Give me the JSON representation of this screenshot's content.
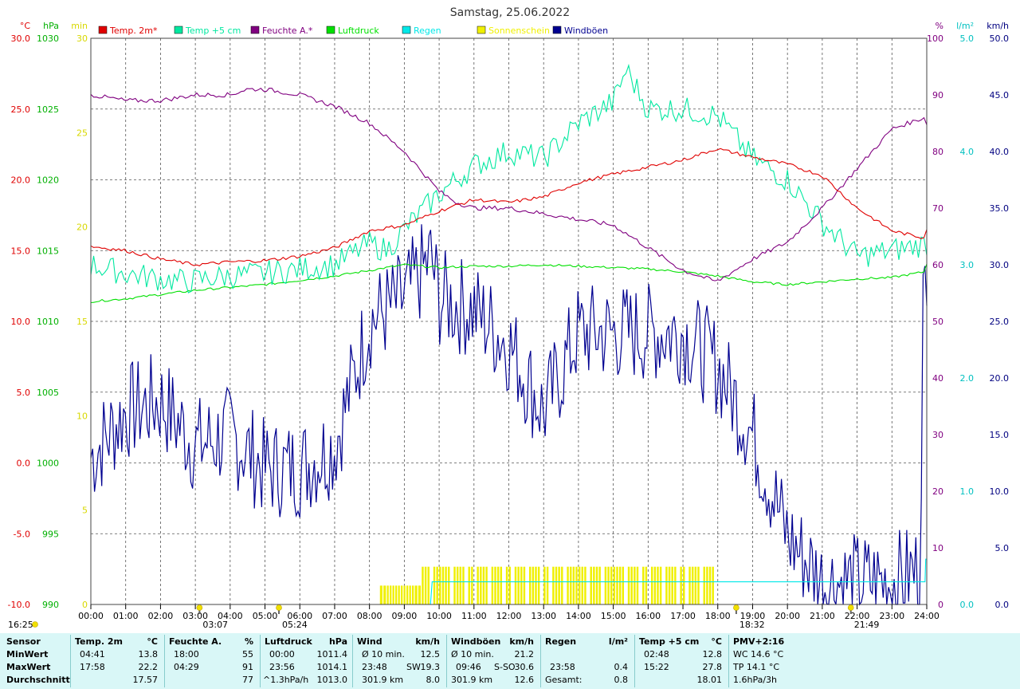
{
  "chart_data": {
    "type": "line",
    "title": "Samstag, 25.06.2022",
    "xlim": [
      "00:00",
      "24:00"
    ],
    "x_ticks": [
      "00:00",
      "01:00",
      "02:00",
      "03:00",
      "04:00",
      "05:00",
      "06:00",
      "07:00",
      "08:00",
      "09:00",
      "10:00",
      "11:00",
      "12:00",
      "13:00",
      "14:00",
      "15:00",
      "16:00",
      "17:00",
      "18:00",
      "19:00",
      "20:00",
      "21:00",
      "22:00",
      "23:00",
      "24:00"
    ],
    "axes": {
      "temp": {
        "unit": "°C",
        "ylim": [
          -10,
          30
        ],
        "ticks": [
          "30.0",
          "25.0",
          "20.0",
          "15.0",
          "10.0",
          "5.0",
          "0.0",
          "-5.0",
          "-10.0"
        ]
      },
      "pressure": {
        "unit": "hPa",
        "ylim": [
          990,
          1030
        ],
        "ticks": [
          "1030",
          "1025",
          "1020",
          "1015",
          "1010",
          "1005",
          "1000",
          "995",
          "990"
        ]
      },
      "sunshine": {
        "unit": "min",
        "ylim": [
          0,
          30
        ],
        "ticks": [
          "30",
          "25",
          "20",
          "15",
          "10",
          "5",
          "0"
        ]
      },
      "humidity": {
        "unit": "%",
        "ylim": [
          0,
          100
        ],
        "ticks": [
          "100",
          "90",
          "80",
          "70",
          "60",
          "50",
          "40",
          "30",
          "20",
          "10",
          "0"
        ]
      },
      "rain": {
        "unit": "l/m²",
        "ylim": [
          0,
          5
        ],
        "ticks": [
          "5.0",
          "4.0",
          "3.0",
          "2.0",
          "1.0",
          "0.0"
        ]
      },
      "wind": {
        "unit": "km/h",
        "ylim": [
          0,
          50
        ],
        "ticks": [
          "50.0",
          "45.0",
          "40.0",
          "35.0",
          "30.0",
          "25.0",
          "20.0",
          "15.0",
          "10.0",
          "5.0",
          "0.0"
        ]
      }
    },
    "legend": [
      {
        "name": "Temp. 2m*",
        "color": "#e00000"
      },
      {
        "name": "Temp +5 cm",
        "color": "#00e8a0"
      },
      {
        "name": "Feuchte A.*",
        "color": "#800080"
      },
      {
        "name": "Luftdruck",
        "color": "#00e000"
      },
      {
        "name": "Regen",
        "color": "#00e8e8"
      },
      {
        "name": "Sonnenschein",
        "color": "#f0f000"
      },
      {
        "name": "Windböen",
        "color": "#000090"
      }
    ],
    "series": [
      {
        "name": "Temp. 2m*",
        "axis": "temp",
        "x": [
          0,
          1,
          2,
          3,
          4,
          5,
          6,
          7,
          8,
          9,
          10,
          11,
          12,
          13,
          14,
          15,
          16,
          17,
          17.97,
          19,
          20,
          21,
          22,
          23,
          23.9,
          24
        ],
        "y": [
          15.3,
          15.0,
          14.4,
          14.0,
          14.2,
          14.3,
          14.6,
          15.2,
          16.4,
          16.8,
          17.8,
          18.6,
          18.4,
          18.8,
          19.8,
          20.4,
          20.9,
          21.4,
          22.2,
          21.6,
          21.1,
          20.3,
          18.0,
          16.4,
          15.9,
          16.5
        ]
      },
      {
        "name": "Temp +5 cm",
        "axis": "temp",
        "x": [
          0,
          1,
          2,
          2.8,
          3.5,
          5,
          6,
          7,
          8,
          8.5,
          9,
          10,
          11,
          12,
          13,
          14,
          15,
          15.37,
          16,
          17,
          18,
          19,
          20,
          21,
          22,
          23,
          24
        ],
        "y": [
          14.0,
          13.4,
          13.0,
          12.8,
          13.1,
          13.4,
          13.7,
          14.0,
          15.5,
          15.0,
          16.5,
          19.0,
          21.0,
          22.0,
          21.5,
          24.0,
          25.5,
          27.8,
          25.0,
          25.0,
          24.5,
          21.5,
          20.0,
          17.0,
          14.6,
          15.0,
          15.5
        ]
      },
      {
        "name": "Feuchte A.*",
        "axis": "humidity",
        "x": [
          0,
          1,
          2,
          3,
          4,
          4.48,
          5,
          6,
          7,
          8,
          9,
          10,
          10.5,
          11,
          12,
          13,
          14,
          15,
          16,
          17,
          17.97,
          19,
          20,
          21,
          22,
          23,
          23.93,
          24
        ],
        "y": [
          90,
          89,
          89,
          90,
          90,
          91,
          91,
          90,
          88,
          85,
          80,
          73,
          71,
          70,
          70,
          69,
          68,
          67,
          63,
          59,
          57,
          61,
          64,
          70,
          77,
          84,
          86,
          85
        ]
      },
      {
        "name": "Luftdruck",
        "axis": "pressure",
        "x": [
          0,
          1,
          2,
          3,
          4,
          5,
          6,
          7,
          8,
          9,
          10,
          11,
          12,
          13,
          14,
          15,
          16,
          17,
          18,
          19,
          20,
          21,
          22,
          23,
          23.93,
          24
        ],
        "y": [
          1011.4,
          1011.6,
          1011.9,
          1012.2,
          1012.4,
          1012.6,
          1012.9,
          1013.2,
          1013.6,
          1014.0,
          1013.8,
          1013.9,
          1013.9,
          1014.0,
          1013.9,
          1013.8,
          1013.7,
          1013.5,
          1013.2,
          1012.8,
          1012.6,
          1012.8,
          1013.0,
          1013.1,
          1013.5,
          1014.1
        ]
      },
      {
        "name": "Regen",
        "axis": "rain",
        "x": [
          0,
          9.75,
          9.8,
          23.95,
          23.97,
          24
        ],
        "y": [
          0,
          0,
          0.2,
          0.2,
          0.4,
          0.4
        ]
      },
      {
        "name": "Windböen",
        "axis": "wind",
        "x": [
          0,
          1,
          2,
          3,
          4,
          5,
          6,
          7,
          8,
          9,
          9.77,
          10,
          11,
          12,
          13,
          14,
          15,
          16,
          17,
          18,
          19,
          20,
          21,
          22,
          23,
          23.8,
          23.9,
          24
        ],
        "y": [
          13,
          17,
          18,
          14,
          15,
          12,
          12,
          14,
          25,
          27,
          30.6,
          27,
          26,
          23,
          17,
          24,
          24,
          24,
          24,
          21,
          15,
          6,
          2,
          2,
          2,
          3,
          28,
          25
        ]
      },
      {
        "name": "Sonnenschein",
        "axis": "sunshine",
        "x": [
          8.3,
          8.5,
          9.3,
          9.5,
          10,
          11,
          12,
          13,
          14,
          15,
          16,
          17,
          18.0
        ],
        "y": [
          1,
          1,
          1,
          2,
          2,
          2,
          2,
          2,
          2,
          2,
          2,
          2,
          2
        ]
      }
    ],
    "markers": [
      {
        "label": "03:07",
        "x": 3.12
      },
      {
        "label": "05:24",
        "x": 5.4
      },
      {
        "label": "18:32",
        "x": 18.53
      },
      {
        "label": "21:49",
        "x": 21.82
      }
    ],
    "corner_label": "16:25"
  },
  "stats": {
    "row_labels": {
      "title": "Sensor",
      "min": "MinWert",
      "max": "MaxWert",
      "avg": "Durchschnitt"
    },
    "temp2m": {
      "title": "Temp. 2m",
      "unit": "°C",
      "min_t": "04:41",
      "min_v": "13.8",
      "max_t": "17:58",
      "max_v": "22.2",
      "avg": "17.57"
    },
    "feuchte": {
      "title": "Feuchte A.",
      "unit": "%",
      "min_t": "18:00",
      "min_v": "55",
      "max_t": "04:29",
      "max_v": "91",
      "avg": "77"
    },
    "luftdruck": {
      "title": "Luftdruck",
      "unit": "hPa",
      "min_t": "00:00",
      "min_v": "1011.4",
      "max_t": "23:56",
      "max_v": "1014.1",
      "avg_t": "^1.3hPa/h",
      "avg": "1013.0"
    },
    "wind": {
      "title": "Wind",
      "unit": "km/h",
      "min_t": "Ø 10 min.",
      "min_v": "12.5",
      "max_t": "23:48",
      "max_m": "SW",
      "max_v": "19.3",
      "avg_t": "301.9 km",
      "avg": "8.0"
    },
    "boeen": {
      "title": "Windböen",
      "unit": "km/h",
      "min_t": "Ø 10 min.",
      "min_v": "21.2",
      "max_t": "09:46",
      "max_m": "S-SO",
      "max_v": "30.6",
      "avg_t": "301.9 km",
      "avg": "12.6"
    },
    "regen": {
      "title": "Regen",
      "unit": "l/m²",
      "max_t": "23:58",
      "max_v": "0.4",
      "avg_t": "Gesamt:",
      "avg": "0.8"
    },
    "temp5": {
      "title": "Temp +5 cm",
      "unit": "°C",
      "min_t": "02:48",
      "min_v": "12.8",
      "max_t": "15:22",
      "max_v": "27.8",
      "avg": "18.01"
    },
    "pmv": {
      "title": "PMV+2:16",
      "l1": "WC 14.6 °C",
      "l2": "TP 14.1 °C",
      "l3": "1.6hPa/3h"
    }
  }
}
